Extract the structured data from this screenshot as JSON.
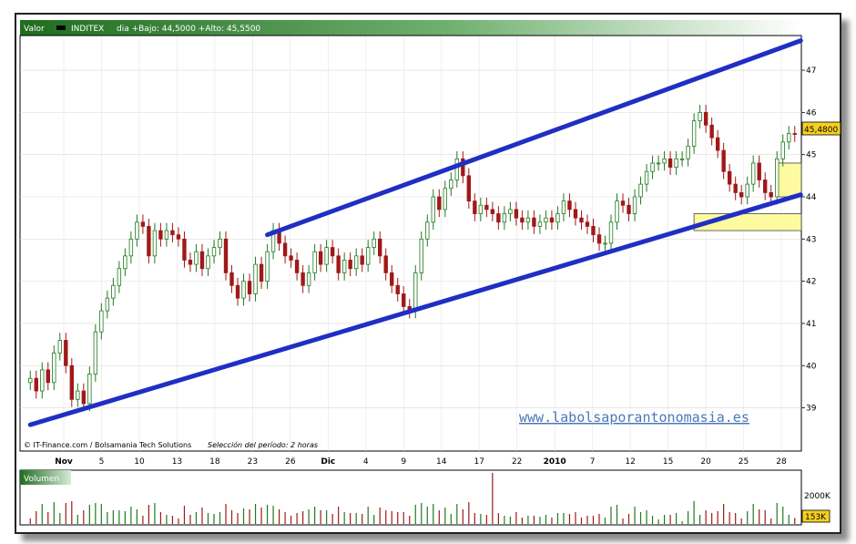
{
  "header": {
    "valor_label": "Valor",
    "ticker": "INDITEX",
    "range_text": "dia +Bajo: 44,5000 +Alto: 45,5500"
  },
  "last_price_label": "45,4800",
  "footer": {
    "source": "© IT-Finance.com / Bolsamania Tech Solutions",
    "period": "Selección del período: 2 horas"
  },
  "watermark": "www.labolsaporantonomasia.es",
  "volume": {
    "label": "Volumen",
    "ticks": [
      "2000K",
      "153K"
    ]
  },
  "colors": {
    "header_green": "#2e8a2e",
    "channel_blue": "#1f2fc4",
    "candle_green": "#1f7a1f",
    "candle_red": "#a01818",
    "zone_yellow": "#fdfaa0",
    "price_box": "#f5d020"
  },
  "chart_data": {
    "type": "line",
    "title": "INDITEX",
    "ylim": [
      38.3,
      47.8
    ],
    "y_ticks": [
      39,
      40,
      41,
      42,
      43,
      44,
      45,
      46,
      47
    ],
    "x_ticks": [
      "Nov",
      "5",
      "10",
      "13",
      "18",
      "23",
      "26",
      "Dic",
      "4",
      "9",
      "14",
      "17",
      "22",
      "2010",
      "7",
      "12",
      "15",
      "20",
      "25",
      "28"
    ],
    "x_ticks_bold": [
      "Nov",
      "Dic",
      "2010"
    ],
    "series": [
      {
        "values": [
          39.7,
          39.4,
          39.9,
          39.6,
          40.3,
          40.6,
          40.0,
          39.2,
          39.4,
          39.1,
          39.8,
          40.8,
          41.3,
          41.6,
          41.9,
          42.3,
          42.6,
          43.0,
          43.4,
          43.3,
          42.6,
          43.2,
          43.0,
          43.2,
          43.1,
          43.0,
          42.5,
          42.4,
          42.7,
          42.3,
          42.6,
          42.8,
          43.0,
          42.2,
          41.9,
          41.6,
          42.0,
          41.7,
          42.4,
          42.0,
          42.7,
          43.2,
          42.9,
          42.6,
          42.5,
          42.2,
          41.9,
          42.2,
          42.7,
          42.4,
          42.8,
          42.6,
          42.2,
          42.5,
          42.3,
          42.6,
          42.4,
          42.8,
          43.0,
          42.6,
          42.2,
          41.9,
          41.7,
          41.4,
          41.3,
          42.2,
          43.0,
          43.4,
          44.0,
          43.7,
          44.2,
          44.4,
          44.9,
          44.5,
          43.9,
          43.6,
          43.8,
          43.7,
          43.6,
          43.4,
          43.6,
          43.7,
          43.5,
          43.4,
          43.5,
          43.3,
          43.4,
          43.5,
          43.4,
          43.6,
          43.9,
          43.7,
          43.5,
          43.4,
          43.3,
          43.1,
          42.9,
          42.9,
          43.4,
          43.9,
          43.8,
          43.6,
          44.0,
          44.3,
          44.6,
          44.8,
          44.8,
          44.9,
          44.7,
          44.9,
          44.9,
          45.2,
          45.8,
          46.0,
          45.7,
          45.4,
          45.1,
          44.6,
          44.3,
          44.1,
          44.0,
          44.3,
          44.8,
          44.4,
          44.1,
          44.0,
          44.9,
          45.3,
          45.5,
          45.48
        ],
        "last": 45.48
      }
    ],
    "channel": {
      "upper": {
        "from": {
          "index": 40,
          "value": 43.1
        },
        "to": {
          "index": 130,
          "value": 47.7
        }
      },
      "lower": {
        "from": {
          "index": 0,
          "value": 38.6
        },
        "to": {
          "index": 130,
          "value": 44.05
        }
      }
    },
    "zones": [
      {
        "from_index": 112,
        "y_low": 43.2,
        "y_high": 43.6
      },
      {
        "from_index": 126,
        "y_low": 44.0,
        "y_high": 44.8
      }
    ],
    "volume_spikes": {
      "max_index": 78
    }
  }
}
